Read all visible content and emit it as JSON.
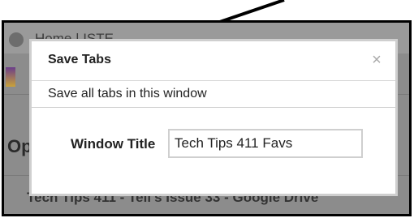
{
  "background_window": {
    "tab_title": "Home | ISTE",
    "section_heading": "Op",
    "list_item_text": "Tech Tips 411 - Tell's Issue 33 - Google Drive"
  },
  "dialog": {
    "title": "Save Tabs",
    "close_glyph": "×",
    "description": "Save all tabs in this window",
    "window_title_label": "Window Title",
    "window_title_value": "Tech Tips 411 Favs"
  }
}
